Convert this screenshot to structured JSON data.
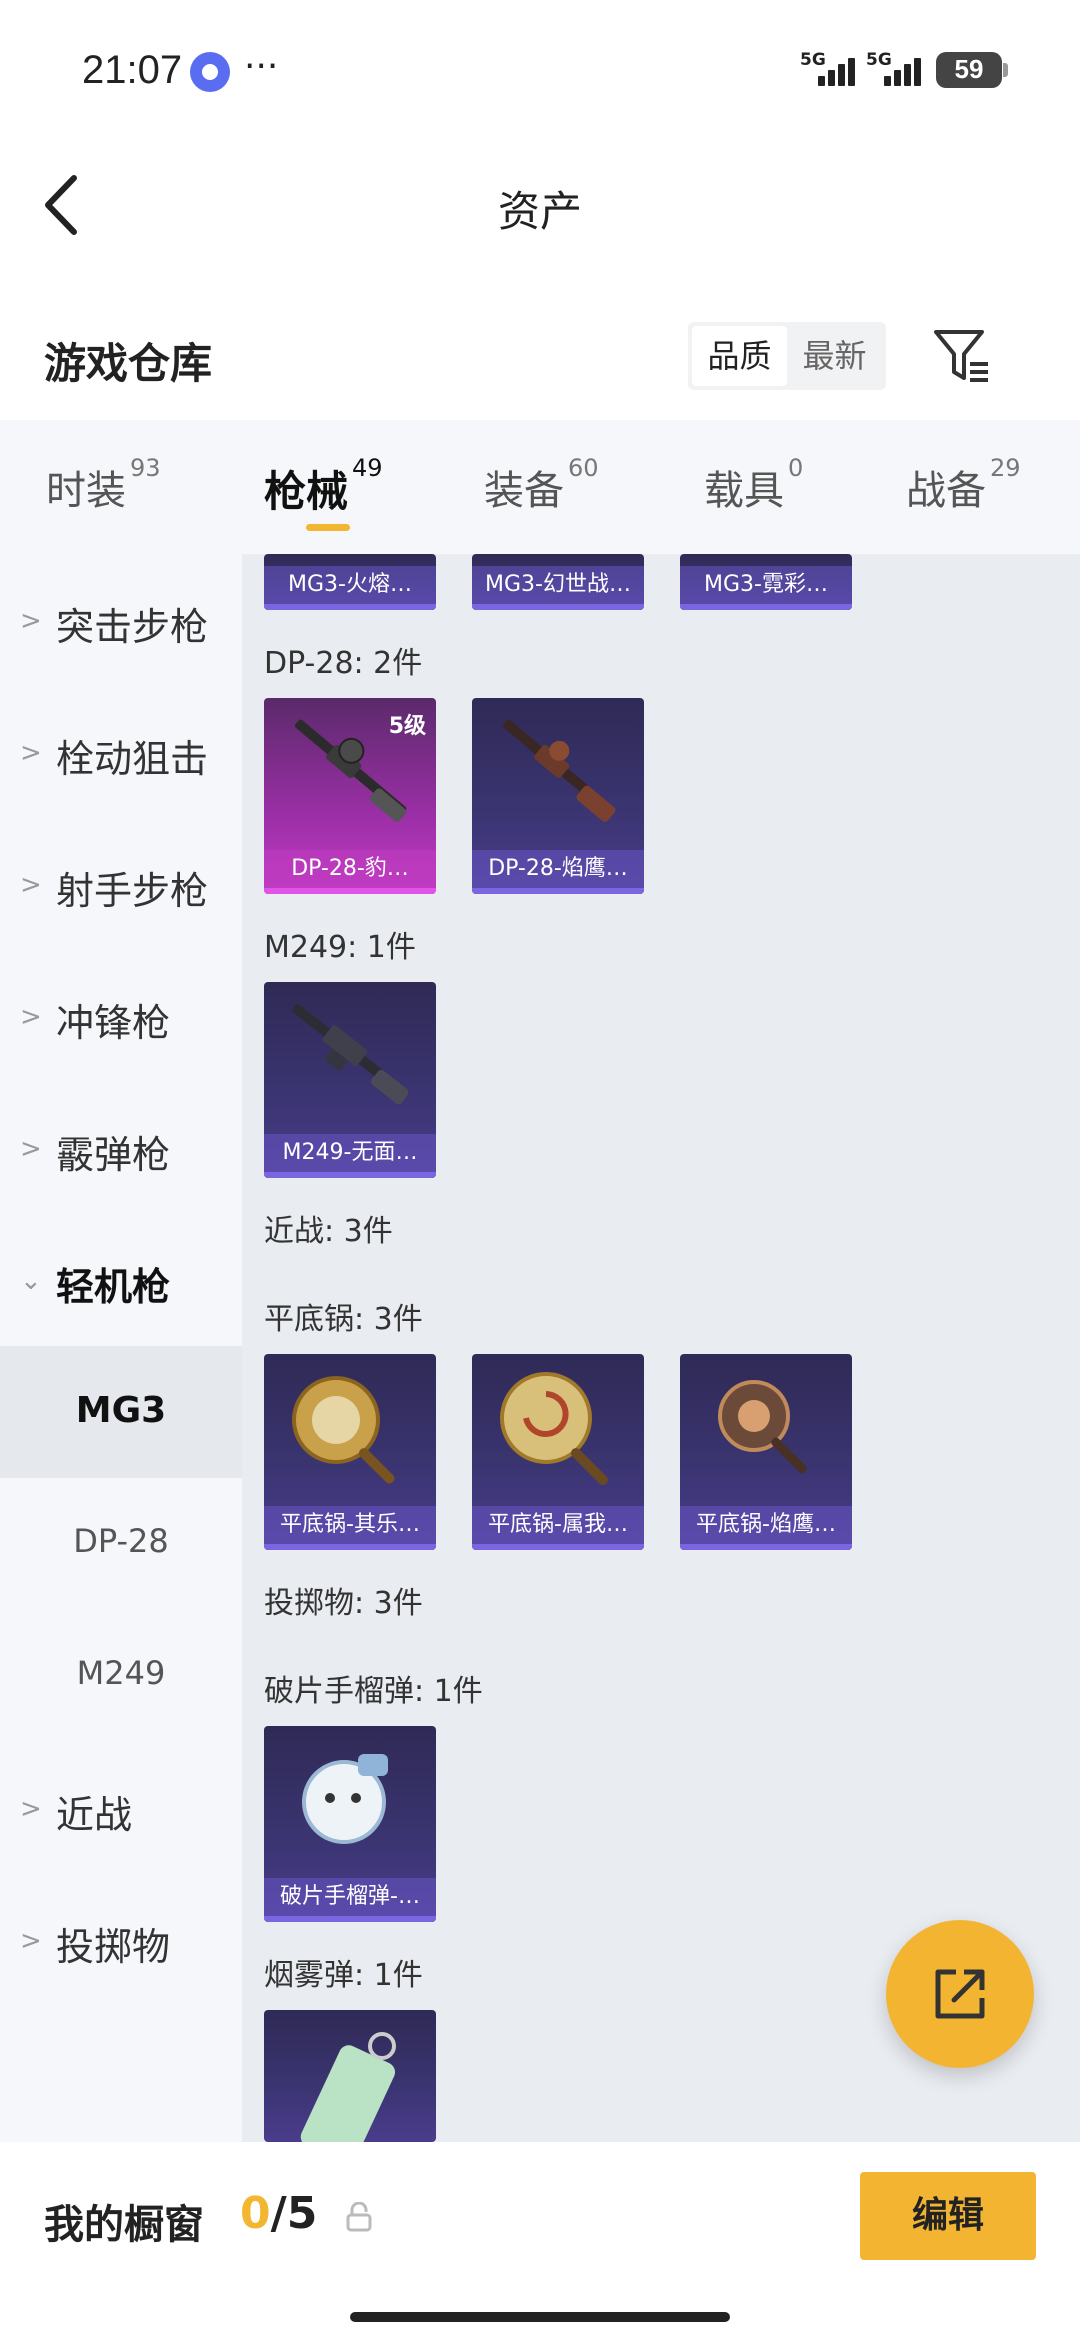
{
  "status_bar": {
    "time": "21:07",
    "dots": "···",
    "sim1": "5G",
    "sim2": "5G",
    "battery": "59",
    "app_badge_icon": "app-badge-icon"
  },
  "header": {
    "title": "资产"
  },
  "warehouse": {
    "title": "游戏仓库",
    "sort_quality": "品质",
    "sort_latest": "最新"
  },
  "tabs": [
    {
      "label": "时装",
      "count": "93"
    },
    {
      "label": "枪械",
      "count": "49"
    },
    {
      "label": "装备",
      "count": "60"
    },
    {
      "label": "载具",
      "count": "0"
    },
    {
      "label": "战备",
      "count": "29"
    }
  ],
  "sidebar": {
    "items": [
      {
        "label": "突击步枪"
      },
      {
        "label": "栓动狙击"
      },
      {
        "label": "射手步枪"
      },
      {
        "label": "冲锋枪"
      },
      {
        "label": "霰弹枪"
      },
      {
        "label": "轻机枪"
      }
    ],
    "sub_items": [
      {
        "label": "MG3"
      },
      {
        "label": "DP-28"
      },
      {
        "label": "M249"
      }
    ],
    "items_after": [
      {
        "label": "近战"
      },
      {
        "label": "投掷物"
      }
    ]
  },
  "content": {
    "mg3_cards": [
      {
        "name": "MG3-火熔…"
      },
      {
        "name": "MG3-幻世战…"
      },
      {
        "name": "MG3-霓彩…"
      }
    ],
    "dp28_label": "DP-28: 2件",
    "dp28_cards": [
      {
        "name": "DP-28-豹…",
        "tier": "5级"
      },
      {
        "name": "DP-28-焰鹰…"
      }
    ],
    "m249_label": "M249: 1件",
    "m249_cards": [
      {
        "name": "M249-无面…"
      }
    ],
    "melee_label": "近战: 3件",
    "pan_label": "平底锅: 3件",
    "pan_cards": [
      {
        "name": "平底锅-其乐…"
      },
      {
        "name": "平底锅-属我…"
      },
      {
        "name": "平底锅-焰鹰…"
      }
    ],
    "throw_label": "投掷物: 3件",
    "frag_label": "破片手榴弹: 1件",
    "frag_cards": [
      {
        "name": "破片手榴弹-…"
      }
    ],
    "smoke_label": "烟雾弹: 1件"
  },
  "bottom": {
    "window_title": "我的橱窗",
    "window_current": "0",
    "window_total": "/5",
    "edit_label": "编辑"
  },
  "colors": {
    "accent": "#f3b531",
    "card_base": "#3a3470",
    "card_legend": "#c43bc8"
  }
}
